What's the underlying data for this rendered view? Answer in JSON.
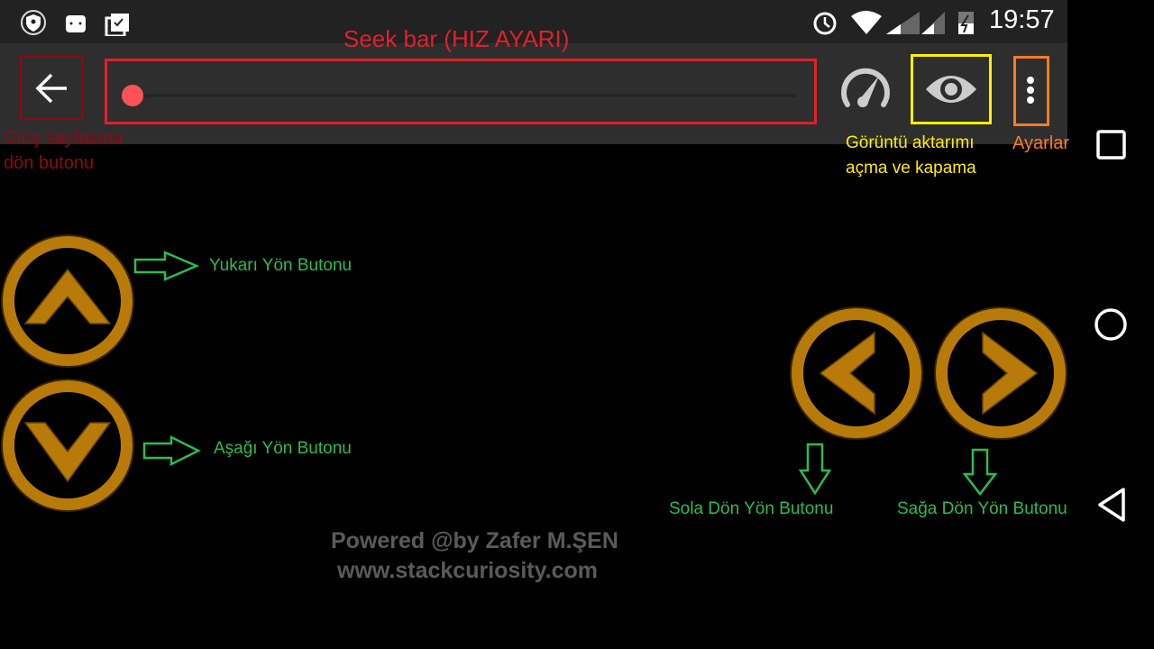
{
  "status_bar": {
    "time": "19:57",
    "icons": [
      "shield-key-icon",
      "android-icon",
      "clipboard-check-icon",
      "alarm-icon",
      "wifi-icon",
      "signal-icon",
      "signal-icon",
      "battery-charging-icon"
    ]
  },
  "toolbar": {
    "back_icon": "arrow-left-icon",
    "seekbar_value": 0,
    "speed_icon": "speedometer-icon",
    "eye_icon": "eye-icon",
    "menu_icon": "more-vertical-icon"
  },
  "annotations": {
    "seekbar": "Seek bar (HIZ AYARI)",
    "back_line1": "Giriş sayfasına",
    "back_line2": "dön butonu",
    "eye_line1": "Görüntü aktarımı",
    "eye_line2": "açma ve kapama",
    "settings": "Ayarlar",
    "up": "Yukarı Yön Butonu",
    "down": "Aşağı Yön Butonu",
    "left": "Sola Dön Yön Butonu",
    "right": "Sağa Dön Yön Butonu"
  },
  "credits": {
    "line1": "Powered @by Zafer M.ŞEN",
    "line2": "www.stackcuriosity.com"
  },
  "colors": {
    "seek_red": "#ff5252",
    "annot_red": "#e0202a",
    "dark_red": "#8b0a14",
    "yellow": "#ffee00",
    "orange": "#ff7b22",
    "green": "#2dbb4e",
    "gold": "#b87a08"
  }
}
